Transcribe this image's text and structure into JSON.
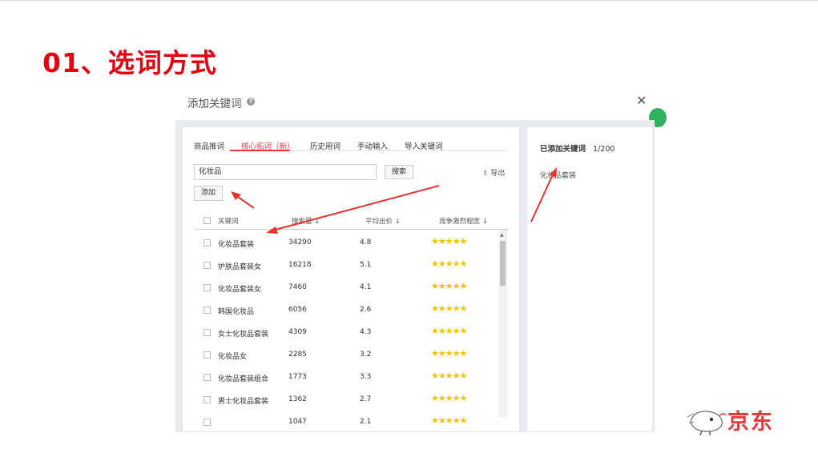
{
  "slide": {
    "title": "01、选词方式"
  },
  "dialog": {
    "title": "添加关键词",
    "tabs": [
      {
        "label": "商品推词"
      },
      {
        "label": "核心拓词（新）"
      },
      {
        "label": "历史用词"
      },
      {
        "label": "手动输入"
      },
      {
        "label": "导入关键词"
      }
    ],
    "search": {
      "value": "化妆品",
      "button": "搜索"
    },
    "export_label": "导出",
    "add_label": "添加",
    "table": {
      "headers": {
        "keyword": "关键词",
        "search_volume": "搜索量 ↓",
        "avg_bid": "平均出价 ↓",
        "competition": "竞争激烈程度 ↓"
      },
      "rows": [
        {
          "keyword": "化妆品套装",
          "volume": "34290",
          "bid": "4.8",
          "stars": "★★★★★"
        },
        {
          "keyword": "护肤品套装女",
          "volume": "16218",
          "bid": "5.1",
          "stars": "★★★★★"
        },
        {
          "keyword": "化妆品套装女",
          "volume": "7460",
          "bid": "4.1",
          "stars": "★★★★★"
        },
        {
          "keyword": "韩国化妆品",
          "volume": "6056",
          "bid": "2.6",
          "stars": "★★★★★"
        },
        {
          "keyword": "女士化妆品套装",
          "volume": "4309",
          "bid": "4.3",
          "stars": "★★★★★"
        },
        {
          "keyword": "化妆品女",
          "volume": "2285",
          "bid": "3.2",
          "stars": "★★★★★"
        },
        {
          "keyword": "化妆品套装组合",
          "volume": "1773",
          "bid": "3.3",
          "stars": "★★★★★"
        },
        {
          "keyword": "男士化妆品套装",
          "volume": "1362",
          "bid": "2.7",
          "stars": "★★★★★"
        },
        {
          "keyword": "",
          "volume": "1047",
          "bid": "2.1",
          "stars": "★★★★★"
        }
      ]
    },
    "added": {
      "label": "已添加关键词",
      "count": "1/200",
      "items": [
        "化妆品套装"
      ]
    }
  },
  "brand": {
    "logo_text": "京东"
  },
  "colors": {
    "title_red": "#e60012",
    "accent_red": "#e4393c",
    "star_yellow": "#f5c200",
    "arrow_red": "#e8322e"
  }
}
